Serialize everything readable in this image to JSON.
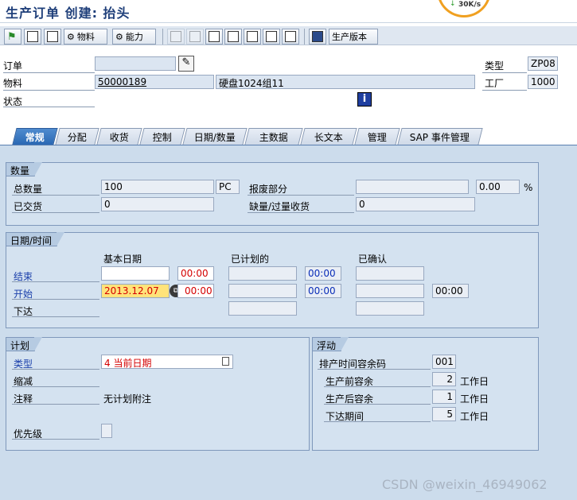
{
  "window": {
    "title": "生产订单 创建: 抬头"
  },
  "network": {
    "speed": "30K/s"
  },
  "toolbar": {
    "material_label": "物料",
    "capacity_label": "能力",
    "prod_version_label": "生产版本"
  },
  "header": {
    "order_label": "订单",
    "order_value": "",
    "material_label": "物料",
    "material_value": "50000189",
    "material_desc": "硬盘1024组11",
    "status_label": "状态",
    "type_label": "类型",
    "type_value": "ZP08",
    "plant_label": "工厂",
    "plant_value": "1000"
  },
  "tabs": [
    "常规",
    "分配",
    "收货",
    "控制",
    "日期/数量",
    "主数据",
    "长文本",
    "管理",
    "SAP 事件管理"
  ],
  "quantity": {
    "title": "数量",
    "total_label": "总数量",
    "total_value": "100",
    "unit": "PC",
    "scrap_label": "报废部分",
    "scrap_value": "",
    "scrap_pct": "0.00",
    "pct_sign": "%",
    "delivered_label": "已交货",
    "delivered_value": "0",
    "short_label": "缺量/过量收货",
    "short_value": "0"
  },
  "dates": {
    "title": "日期/时间",
    "col_basic": "基本日期",
    "col_scheduled": "已计划的",
    "col_confirmed": "已确认",
    "finish_label": "结束",
    "finish_date": "",
    "finish_time": "00:00",
    "finish_sched_time": "00:00",
    "start_label": "开始",
    "start_date": "2013.12.07",
    "start_time": "00:00",
    "start_sched_time": "00:00",
    "start_conf_time": "00:00",
    "release_label": "下达"
  },
  "planning": {
    "title": "计划",
    "type_label": "类型",
    "type_value": "4 当前日期",
    "reduction_label": "缩减",
    "note_label": "注释",
    "note_value": "无计划附注",
    "priority_label": "优先级"
  },
  "float": {
    "title": "浮动",
    "margin_key_label": "排产时间容余码",
    "margin_key_value": "001",
    "before_label": "生产前容余",
    "before_value": "2",
    "after_label": "生产后容余",
    "after_value": "1",
    "release_label": "下达期间",
    "release_value": "5",
    "unit": "工作日"
  },
  "watermark": "CSDN @weixin_46949062",
  "colors": {
    "accent": "#2a68b3",
    "error": "#d40000",
    "highlight": "#ffe37a"
  }
}
